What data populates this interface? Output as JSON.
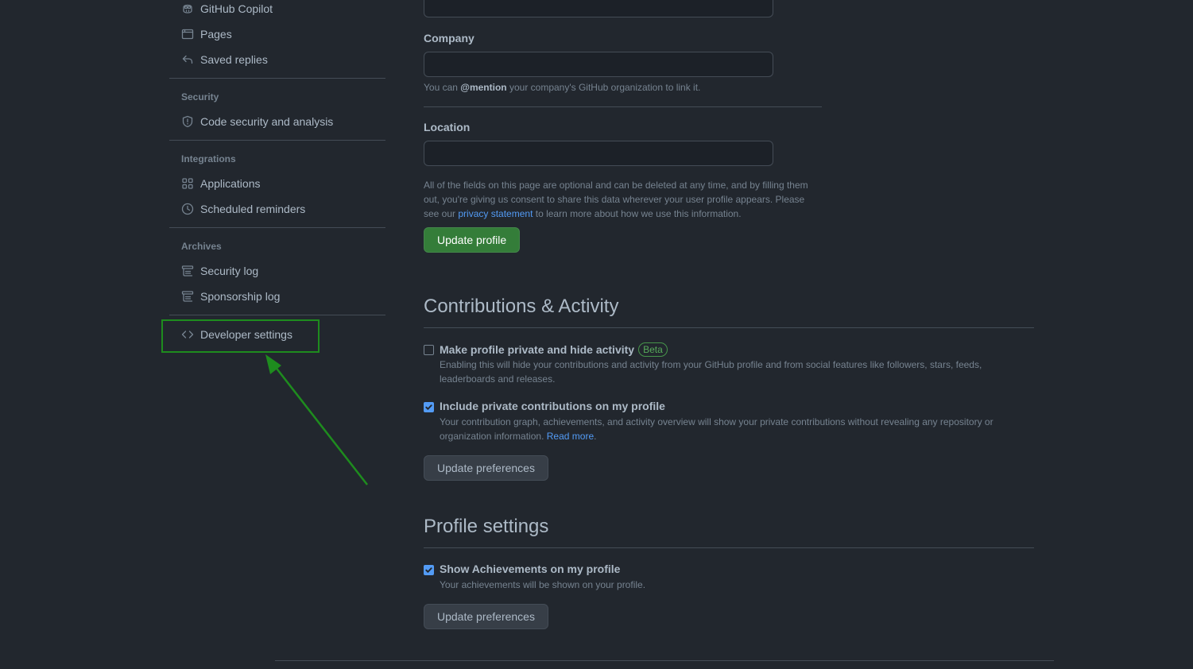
{
  "sidebar": {
    "items": {
      "copilot": "GitHub Copilot",
      "pages": "Pages",
      "saved_replies": "Saved replies",
      "code_security": "Code security and analysis",
      "applications": "Applications",
      "scheduled_reminders": "Scheduled reminders",
      "security_log": "Security log",
      "sponsorship_log": "Sponsorship log",
      "developer_settings": "Developer settings"
    },
    "headings": {
      "security": "Security",
      "integrations": "Integrations",
      "archives": "Archives"
    }
  },
  "profile_form": {
    "company_label": "Company",
    "company_value": "",
    "company_hint_prefix": "You can ",
    "company_hint_mention": "@mention",
    "company_hint_suffix": " your company's GitHub organization to link it.",
    "location_label": "Location",
    "location_value": "",
    "disclaimer_prefix": "All of the fields on this page are optional and can be deleted at any time, and by filling them out, you're giving us consent to share this data wherever your user profile appears. Please see our ",
    "disclaimer_link": "privacy statement",
    "disclaimer_suffix": " to learn more about how we use this information.",
    "update_button": "Update profile"
  },
  "contributions": {
    "title": "Contributions & Activity",
    "private_label": "Make profile private and hide activity",
    "private_badge": "Beta",
    "private_checked": false,
    "private_desc": "Enabling this will hide your contributions and activity from your GitHub profile and from social features like followers, stars, feeds, leaderboards and releases.",
    "include_label": "Include private contributions on my profile",
    "include_checked": true,
    "include_desc": "Your contribution graph, achievements, and activity overview will show your private contributions without revealing any repository or organization information. ",
    "include_link": "Read more",
    "include_link_suffix": ".",
    "update_button": "Update preferences"
  },
  "profile_settings": {
    "title": "Profile settings",
    "achievements_label": "Show Achievements on my profile",
    "achievements_checked": true,
    "achievements_desc": "Your achievements will be shown on your profile.",
    "update_button": "Update preferences"
  },
  "colors": {
    "background": "#22272e",
    "primary_button": "#347d39",
    "link": "#539bf5",
    "annotation": "#1e8c1e"
  }
}
